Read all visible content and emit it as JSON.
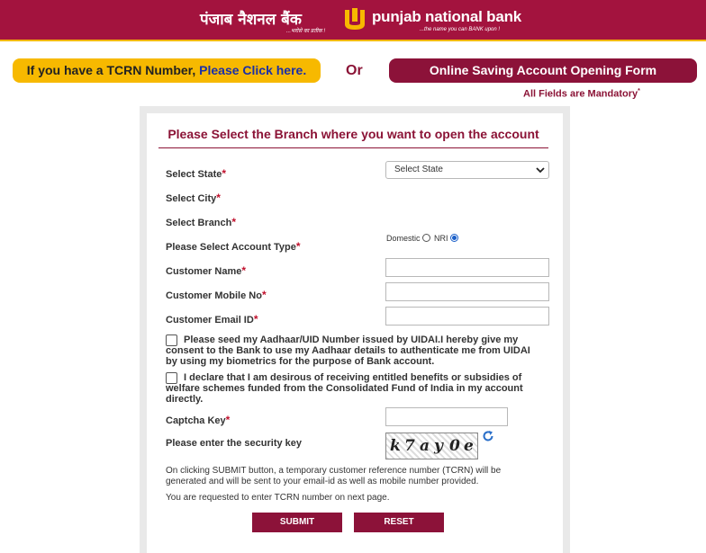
{
  "header": {
    "hindi_name": "पंजाब नैशनल बैंक",
    "hindi_tagline": "...भरोसे का प्रतीक !",
    "english_name": "punjab national bank",
    "english_tagline": "...the name you can BANK upon !"
  },
  "top": {
    "tcrn_text": "If you have a TCRN Number, ",
    "tcrn_link": "Please Click here.",
    "or_text": "Or",
    "form_title": "Online Saving Account Opening Form",
    "mandatory_text": "All Fields are Mandatory",
    "mandatory_mark": "*"
  },
  "form": {
    "title": "Please Select the Branch where you want to open the account",
    "required_mark": "*",
    "state_label": "Select State",
    "state_value": "Select State",
    "city_label": "Select City",
    "branch_label": "Select Branch",
    "account_type_label": "Please Select Account Type",
    "account_types": [
      "Domestic",
      "NRI"
    ],
    "selected_account_type": "NRI",
    "customer_name_label": "Customer Name",
    "mobile_label": "Customer Mobile No",
    "email_label": "Customer Email ID",
    "aadhaar_consent": "Please seed my Aadhaar/UID Number issued by UIDAI.I hereby give my consent to the Bank to use my Aadhaar details to authenticate me from UIDAI by using my biometrics for the purpose of Bank account.",
    "subsidy_declaration": "I declare that I am desirous of receiving entitled benefits or subsidies of welfare schemes funded from the Consolidated Fund of India in my account directly.",
    "captcha_label": "Captcha Key",
    "security_key_label": "Please enter the security key",
    "captcha_chars": [
      "k",
      "7",
      "a",
      "y",
      "0",
      "e"
    ],
    "info_1": "On clicking SUBMIT button, a temporary customer reference number (TCRN) will be generated and will be sent to your email-id as well as mobile number provided.",
    "info_2": "You are requested to enter TCRN number on next page.",
    "submit_label": "SUBMIT",
    "reset_label": "RESET"
  },
  "colors": {
    "brand_maroon": "#a3133e",
    "brand_yellow": "#f7b900",
    "button_maroon": "#8c1239"
  },
  "icons": {
    "logo": "pnb-logo-icon",
    "dropdown": "chevron-down-icon",
    "refresh": "refresh-icon"
  }
}
